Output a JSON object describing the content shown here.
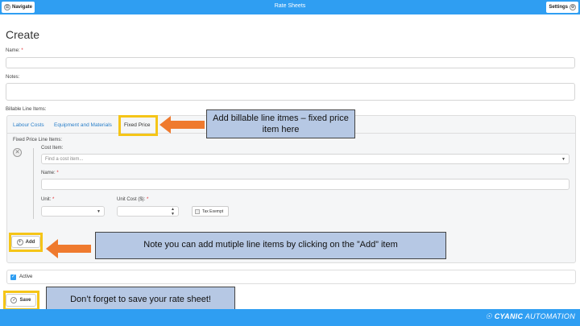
{
  "topbar": {
    "title": "Rate Sheets",
    "navigate_label": "Navigate",
    "settings_label": "Settings"
  },
  "page": {
    "heading": "Create",
    "name_label": "Name:",
    "name_required": "*",
    "notes_label": "Notes:",
    "billable_label": "Billable Line Items:"
  },
  "tabs": [
    {
      "label": "Labour Costs"
    },
    {
      "label": "Equipment and Materials"
    },
    {
      "label": "Fixed Price"
    }
  ],
  "fixed_price": {
    "section_label": "Fixed Price Line Items:",
    "cost_item_label": "Cost Item:",
    "cost_item_placeholder": "Find a cost item...",
    "name_label": "Name:",
    "unit_label": "Unit:",
    "unit_cost_label": "Unit Cost ($):",
    "required": "*",
    "tax_exempt_label": "Tax Exempt"
  },
  "add_label": "Add",
  "active_label": "Active",
  "save_label": "Save",
  "callouts": {
    "tab_note": "Add billable line itmes – fixed price item here",
    "add_note": "Note you can add mutiple line items by clicking on the ”Add” item",
    "save_note": "Don’t forget to save your rate sheet!"
  },
  "footer": {
    "brand_prefix": "CYANIC",
    "brand_suffix": "AUTOMATION"
  },
  "colors": {
    "primary": "#2f9ef2",
    "highlight": "#f5c518",
    "arrow": "#ef7a2e",
    "callout_bg": "#b6c8e4",
    "required": "#e0272c"
  }
}
